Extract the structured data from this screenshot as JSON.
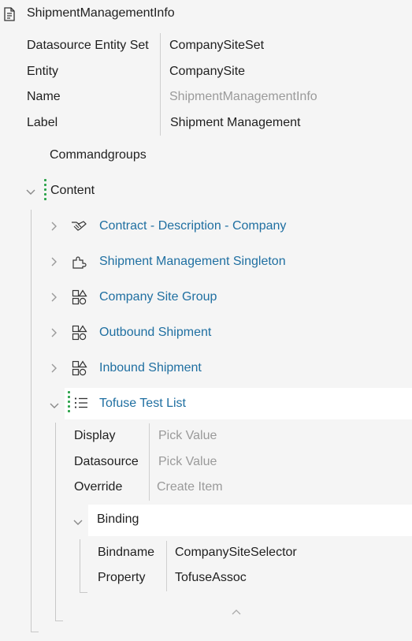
{
  "root": {
    "title": "ShipmentManagementInfo",
    "icon": "document-icon"
  },
  "properties": [
    {
      "label": "Datasource Entity Set",
      "value": "CompanySiteSet",
      "muted": false
    },
    {
      "label": "Entity",
      "value": "CompanySite",
      "muted": false
    },
    {
      "label": "Name",
      "value": "ShipmentManagementInfo",
      "muted": true
    },
    {
      "label": "Label",
      "value": "Shipment Management",
      "muted": false
    }
  ],
  "commandgroups_label": "Commandgroups",
  "content": {
    "label": "Content",
    "items": [
      {
        "label": "Contract - Description - Company",
        "icon": "handshake-icon"
      },
      {
        "label": "Shipment Management Singleton",
        "icon": "puzzle-icon"
      },
      {
        "label": "Company Site Group",
        "icon": "shapes-icon"
      },
      {
        "label": "Outbound Shipment",
        "icon": "shapes-icon"
      },
      {
        "label": "Inbound Shipment",
        "icon": "shapes-icon"
      }
    ],
    "list": {
      "label": "Tofuse Test List",
      "icon": "list-icon",
      "properties": [
        {
          "label": "Display",
          "value": "Pick Value"
        },
        {
          "label": "Datasource",
          "value": "Pick Value"
        },
        {
          "label": "Override",
          "value": "Create Item"
        }
      ],
      "binding": {
        "label": "Binding",
        "properties": [
          {
            "label": "Bindname",
            "value": "CompanySiteSelector"
          },
          {
            "label": "Property",
            "value": "TofuseAssoc"
          }
        ]
      }
    }
  }
}
